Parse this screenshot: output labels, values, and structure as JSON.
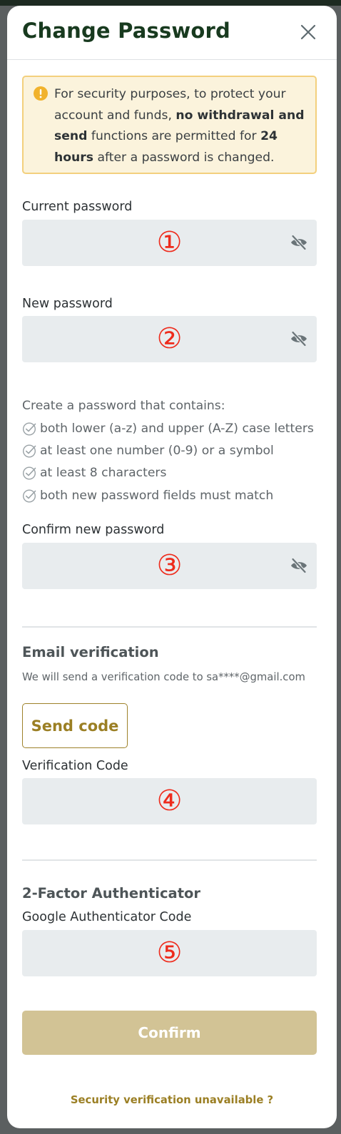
{
  "dialog": {
    "title": "Change Password"
  },
  "notice": {
    "text_1": "For security purposes, to protect your account and funds, ",
    "bold_1": "no withdrawal and send",
    "text_2": " functions are permitted for ",
    "bold_2": "24 hours",
    "text_3": " after a password is changed."
  },
  "current_password": {
    "label": "Current password",
    "value": "",
    "marker": "①"
  },
  "new_password": {
    "label": "New password",
    "value": "",
    "marker": "②"
  },
  "requirements": {
    "intro": "Create a password that contains:",
    "items": [
      "both lower (a-z) and upper (A-Z) case letters",
      "at least one number (0-9) or a symbol",
      "at least 8 characters",
      "both new password fields must match"
    ]
  },
  "confirm_password": {
    "label": "Confirm new password",
    "value": "",
    "marker": "③"
  },
  "email_verification": {
    "title": "Email verification",
    "description": "We will send a verification code to sa****@gmail.com",
    "send_code_label": "Send code",
    "code_label": "Verification Code",
    "code_value": "",
    "marker": "④"
  },
  "two_factor": {
    "title": "2-Factor Authenticator",
    "code_label": "Google Authenticator Code",
    "code_value": "",
    "marker": "⑤"
  },
  "confirm_label": "Confirm",
  "help_link": "Security verification unavailable ?",
  "colors": {
    "title": "#183a1f",
    "accent_gold": "#9b7f24",
    "confirm_disabled": "#d2c395",
    "notice_bg": "#fbf3dc",
    "notice_border": "#f3d07d",
    "marker_red": "#ee2b1c",
    "field_bg": "#e8ecee"
  },
  "icons": {
    "close": "close-icon",
    "notice": "exclamation-circle-icon",
    "eye": "eye-off-icon",
    "check": "check-circle-icon"
  }
}
